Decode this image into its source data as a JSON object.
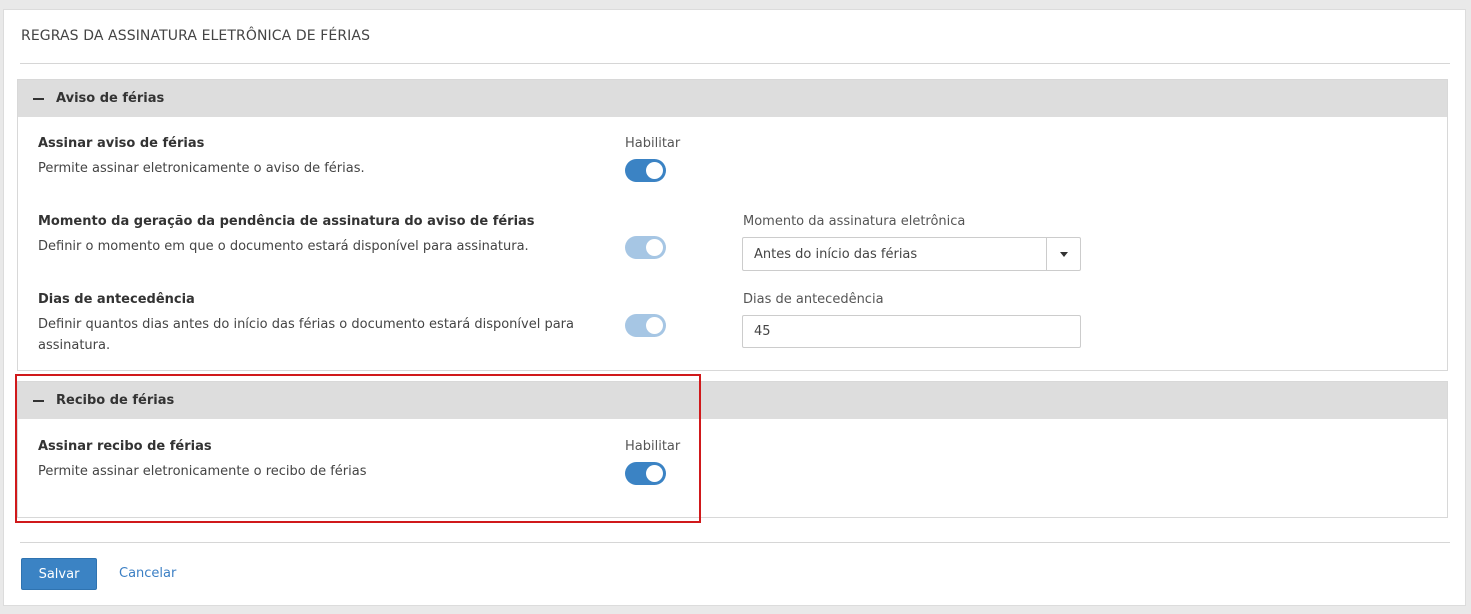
{
  "page": {
    "title": "REGRAS DA ASSINATURA ELETRÔNICA DE FÉRIAS"
  },
  "colors": {
    "accent": "#3b83c4",
    "accent_disabled": "#a6c6e4",
    "highlight": "#d0191b",
    "section_header_bg": "#dddddd"
  },
  "aviso": {
    "section_title": "Aviso de férias",
    "assinar": {
      "title": "Assinar aviso de férias",
      "description": "Permite assinar eletronicamente o aviso de férias.",
      "toggle_label": "Habilitar",
      "enabled": true
    },
    "momento": {
      "title": "Momento da geração da pendência de assinatura do aviso de férias",
      "description": "Definir o momento em que o documento estará disponível para assinatura.",
      "enabled": true,
      "select_label": "Momento da assinatura eletrônica",
      "select_value": "Antes do início das férias"
    },
    "dias": {
      "title": "Dias de antecedência",
      "description_line1": "Definir quantos dias antes do início das férias o documento estará disponível para",
      "description_line2": "assinatura.",
      "enabled": true,
      "input_label": "Dias de antecedência",
      "input_value": "45"
    }
  },
  "recibo": {
    "section_title": "Recibo de férias",
    "assinar": {
      "title": "Assinar recibo de férias",
      "description": "Permite assinar eletronicamente o recibo de férias",
      "toggle_label": "Habilitar",
      "enabled": true
    }
  },
  "actions": {
    "save_label": "Salvar",
    "cancel_label": "Cancelar"
  }
}
